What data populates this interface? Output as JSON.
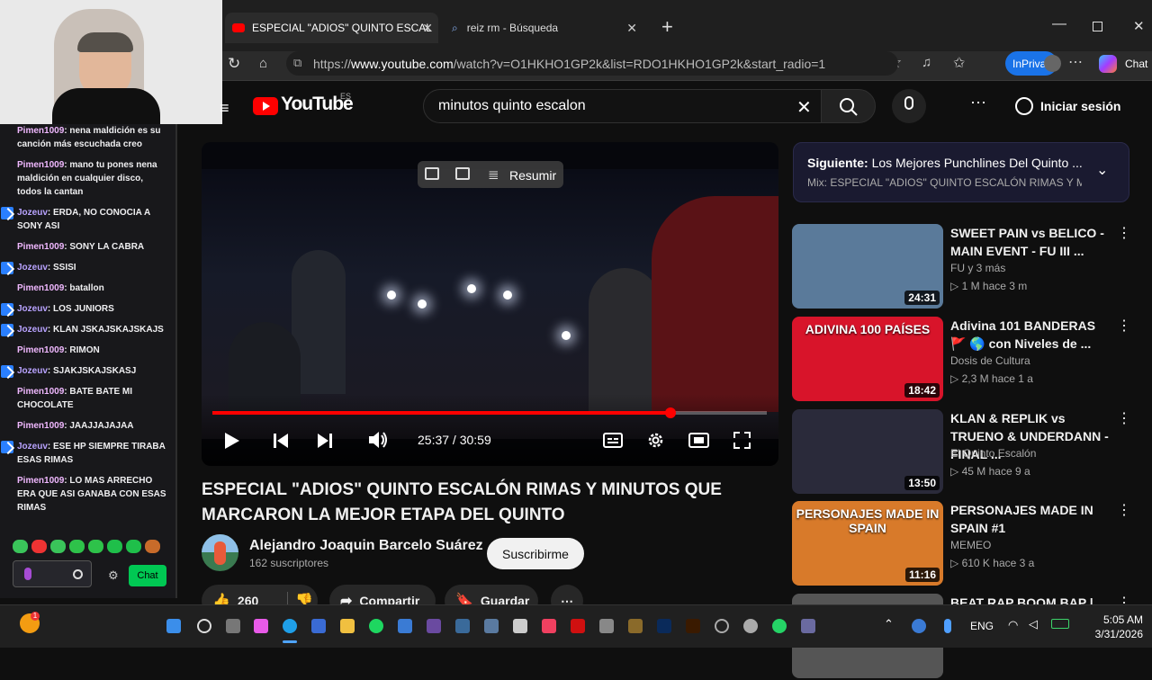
{
  "browser": {
    "tabs": [
      {
        "label": "ESPECIAL \"ADIOS\" QUINTO ESCAL"
      },
      {
        "label": "reiz rm - Búsqueda"
      }
    ],
    "url_prefix": "https://",
    "url_domain": "www.youtube.com",
    "url_path": "/watch?v=O1HKHO1GP2k&list=RDO1HKHO1GP2k&start_radio=1",
    "inprivate_label": "InPrivate",
    "chat_label": "Chat"
  },
  "youtube": {
    "logo_text": "YouTube",
    "region": "ES",
    "search_query": "minutos quinto escalon",
    "signin_label": "Iniciar sesión",
    "player": {
      "summarize_label": "Resumir",
      "time_current": "25:37",
      "time_total": "30:59",
      "timecode": "25:37 / 30:59",
      "progress": 0.827
    },
    "video_title": "ESPECIAL \"ADIOS\" QUINTO ESCALÓN RIMAS Y MINUTOS QUE MARCARON LA MEJOR ETAPA DEL QUINTO",
    "channel_name": "Alejandro Joaquin Barcelo Suárez",
    "subscribers": "162 suscriptores",
    "subscribe_label": "Suscribirme",
    "likes": "260",
    "share_label": "Compartir",
    "save_label": "Guardar",
    "up_next": {
      "label": "Siguiente:",
      "title": "Los Mejores Punchlines Del Quinto ...",
      "mix": "Mix: ESPECIAL \"ADIOS\" QUINTO ESCALÓN RIMAS Y MINU"
    },
    "recommendations": [
      {
        "title": "SWEET PAIN vs BELICO - MAIN EVENT - FU III ...",
        "channel": "FU y 3 más",
        "views": "1 M",
        "age": "hace 3 m",
        "duration": "24:31",
        "thumb_color": "#5a7a9a"
      },
      {
        "title": "Adivina 101 BANDERAS 🚩 🌎 con Niveles de ...",
        "channel": "Dosis de Cultura",
        "views": "2,3 M",
        "age": "hace 1 a",
        "duration": "18:42",
        "thumb_color": "#d8142a",
        "thumb_text": "ADIVINA 100 PAÍSES"
      },
      {
        "title": "KLAN & REPLIK vs TRUENO & UNDERDANN - FINAL ...",
        "channel": "El Quinto Escalón",
        "views": "45 M",
        "age": "hace 9 a",
        "duration": "13:50",
        "thumb_color": "#2a2a3a"
      },
      {
        "title": "PERSONAJES MADE IN SPAIN #1",
        "channel": "MEMEO",
        "views": "610 K",
        "age": "hace 3 a",
        "duration": "11:16",
        "thumb_color": "#d87a2a",
        "thumb_text": "PERSONAJES MADE IN SPAIN"
      },
      {
        "title": "BEAT RAP BOOM BAP |",
        "channel": "",
        "views": "",
        "age": "",
        "duration": "",
        "thumb_color": "#555555"
      }
    ]
  },
  "chat": {
    "messages": [
      {
        "user": "Pimen1009",
        "text": "nena maldición es su canción más escuchada creo",
        "kind": "p"
      },
      {
        "user": "Pimen1009",
        "text": "mano tu pones nena maldición en cualquier disco, todos la cantan",
        "kind": "p"
      },
      {
        "user": "Jozeuv",
        "text": "ERDA, NO CONOCIA A SONY ASI",
        "kind": "j"
      },
      {
        "user": "Pimen1009",
        "text": "SONY LA CABRA",
        "kind": "p"
      },
      {
        "user": "Jozeuv",
        "text": "SSISI",
        "kind": "j"
      },
      {
        "user": "Pimen1009",
        "text": "batallon",
        "kind": "p"
      },
      {
        "user": "Jozeuv",
        "text": "LOS JUNIORS",
        "kind": "j"
      },
      {
        "user": "Jozeuv",
        "text": "KLAN JSKAJSKAJSKAJS",
        "kind": "j"
      },
      {
        "user": "Pimen1009",
        "text": "RIMON",
        "kind": "p"
      },
      {
        "user": "Jozeuv",
        "text": "SJAKJSKAJSKASJ",
        "kind": "j"
      },
      {
        "user": "Pimen1009",
        "text": "BATE BATE MI CHOCOLATE",
        "kind": "p"
      },
      {
        "user": "Pimen1009",
        "text": "JAAJJAJAJAA",
        "kind": "p"
      },
      {
        "user": "Jozeuv",
        "text": "ESE HP SIEMPRE TIRABA ESAS RIMAS",
        "kind": "j"
      },
      {
        "user": "Pimen1009",
        "text": "LO MAS ARRECHO ERA QUE ASI GANABA CON ESAS RIMAS",
        "kind": "p"
      }
    ],
    "send_label": "Chat"
  },
  "taskbar": {
    "lang": "ENG",
    "time": "5:05 AM",
    "date": "3/31/2026"
  },
  "colors": {
    "accent": "#ff0000",
    "brand_edge": "#1a73e8"
  }
}
